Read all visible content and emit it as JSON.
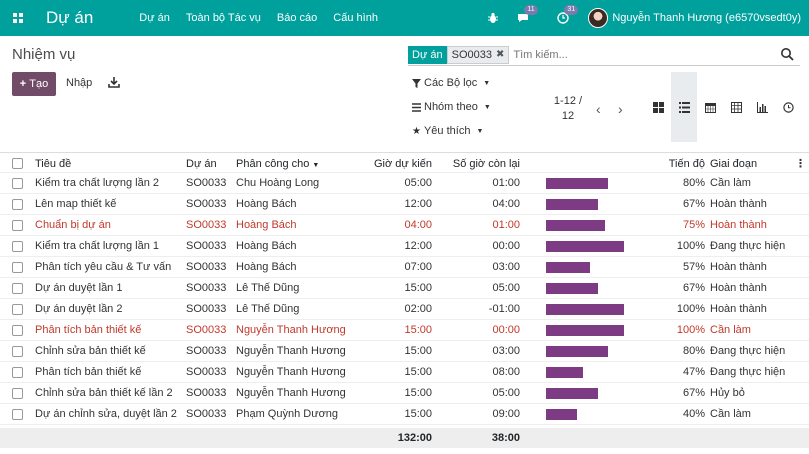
{
  "navbar": {
    "app_title": "Dự án",
    "menu": [
      "Dự án",
      "Toàn bộ Tác vụ",
      "Báo cáo",
      "Cấu hình"
    ],
    "messages_count": "11",
    "activities_count": "31",
    "user_name": "Nguyễn Thanh Hương (e6570vsedt0y)"
  },
  "control": {
    "breadcrumb": "Nhiệm vụ",
    "create_label": "Tạo",
    "import_label": "Nhập",
    "facet_label": "Dự án",
    "facet_value": "SO0033",
    "search_placeholder": "Tìm kiếm...",
    "filters_label": "Các Bộ lọc",
    "groupby_label": "Nhóm theo",
    "favorites_label": "Yêu thích",
    "pager_value": "1-12 /",
    "pager_total": "12"
  },
  "table": {
    "headers": {
      "title": "Tiêu đề",
      "project": "Dự án",
      "assigned": "Phân công cho",
      "planned": "Giờ dự kiến",
      "remaining": "Số giờ còn lại",
      "progress": "Tiến độ",
      "stage": "Giai đoạn"
    },
    "rows": [
      {
        "title": "Kiểm tra chất lượng lần 2",
        "project": "SO0033",
        "assigned": "Chu Hoàng Long",
        "planned": "05:00",
        "remaining": "01:00",
        "progress": 80,
        "progress_label": "80%",
        "stage": "Cần làm",
        "danger": false
      },
      {
        "title": "Lên map thiết kế",
        "project": "SO0033",
        "assigned": "Hoàng Bách",
        "planned": "12:00",
        "remaining": "04:00",
        "progress": 67,
        "progress_label": "67%",
        "stage": "Hoàn thành",
        "danger": false
      },
      {
        "title": "Chuẩn bị dự án",
        "project": "SO0033",
        "assigned": "Hoàng Bách",
        "planned": "04:00",
        "remaining": "01:00",
        "progress": 75,
        "progress_label": "75%",
        "stage": "Hoàn thành",
        "danger": true
      },
      {
        "title": "Kiểm tra chất lượng lần 1",
        "project": "SO0033",
        "assigned": "Hoàng Bách",
        "planned": "12:00",
        "remaining": "00:00",
        "progress": 100,
        "progress_label": "100%",
        "stage": "Đang thực hiện",
        "danger": false
      },
      {
        "title": "Phân tích yêu cầu & Tư vấn",
        "project": "SO0033",
        "assigned": "Hoàng Bách",
        "planned": "07:00",
        "remaining": "03:00",
        "progress": 57,
        "progress_label": "57%",
        "stage": "Hoàn thành",
        "danger": false
      },
      {
        "title": "Dự án duyệt lần 1",
        "project": "SO0033",
        "assigned": "Lê Thế Dũng",
        "planned": "15:00",
        "remaining": "05:00",
        "progress": 67,
        "progress_label": "67%",
        "stage": "Hoàn thành",
        "danger": false
      },
      {
        "title": "Dự án duyệt lần 2",
        "project": "SO0033",
        "assigned": "Lê Thế Dũng",
        "planned": "02:00",
        "remaining": "-01:00",
        "progress": 100,
        "progress_label": "100%",
        "stage": "Hoàn thành",
        "danger": false
      },
      {
        "title": "Phân tích bản thiết kế",
        "project": "SO0033",
        "assigned": "Nguyễn Thanh Hương",
        "planned": "15:00",
        "remaining": "00:00",
        "progress": 100,
        "progress_label": "100%",
        "stage": "Cần làm",
        "danger": true
      },
      {
        "title": "Chỉnh sửa bản thiết kế",
        "project": "SO0033",
        "assigned": "Nguyễn Thanh Hương",
        "planned": "15:00",
        "remaining": "03:00",
        "progress": 80,
        "progress_label": "80%",
        "stage": "Đang thực hiện",
        "danger": false
      },
      {
        "title": "Phân tích bản thiết kế",
        "project": "SO0033",
        "assigned": "Nguyễn Thanh Hương",
        "planned": "15:00",
        "remaining": "08:00",
        "progress": 47,
        "progress_label": "47%",
        "stage": "Đang thực hiện",
        "danger": false
      },
      {
        "title": "Chỉnh sửa bản thiết kế lần 2",
        "project": "SO0033",
        "assigned": "Nguyễn Thanh Hương",
        "planned": "15:00",
        "remaining": "05:00",
        "progress": 67,
        "progress_label": "67%",
        "stage": "Hủy bỏ",
        "danger": false
      },
      {
        "title": "Dự án chỉnh sửa, duyệt lần 2",
        "project": "SO0033",
        "assigned": "Phạm Quỳnh Dương",
        "planned": "15:00",
        "remaining": "09:00",
        "progress": 40,
        "progress_label": "40%",
        "stage": "Cần làm",
        "danger": false
      }
    ],
    "totals": {
      "planned": "132:00",
      "remaining": "38:00"
    }
  },
  "colors": {
    "navbar": "#00a09d",
    "primary_button": "#714b67",
    "progress_bar": "#7c3b82",
    "danger_text": "#c0392b"
  }
}
